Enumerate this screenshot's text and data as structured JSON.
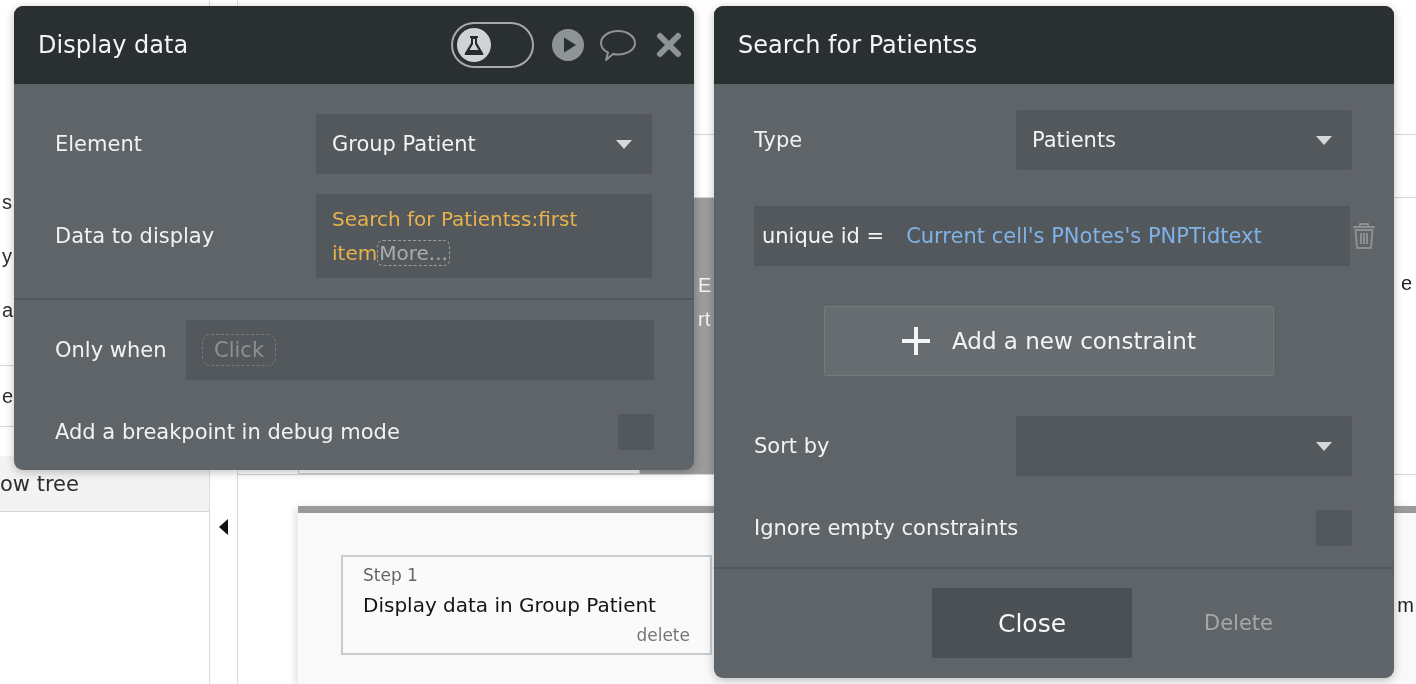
{
  "sidebar": {
    "items": [
      {
        "label": "s",
        "kind": "plain"
      },
      {
        "label": "y",
        "kind": "plain"
      },
      {
        "label": "a",
        "kind": "plain"
      },
      {
        "label": "e",
        "kind": "boxed"
      }
    ],
    "tree_button": {
      "label": "ow tree"
    }
  },
  "canvas": {
    "element_texts": [
      "E",
      "rt"
    ],
    "right_text": "e"
  },
  "workflow": {
    "step": {
      "number": "Step 1",
      "title": "Display data in Group Patient",
      "delete": "delete"
    },
    "right_text": "m"
  },
  "display_data_dialog": {
    "title": "Display data",
    "debug_toggle": {
      "on": false
    },
    "element": {
      "label": "Element",
      "value": "Group Patient"
    },
    "data_to_display": {
      "label": "Data to display",
      "value": "Search for Patientss:first item",
      "more": "More..."
    },
    "only_when": {
      "label": "Only when",
      "prompt": "Click"
    },
    "breakpoint": {
      "label": "Add a breakpoint in debug mode",
      "checked": false
    }
  },
  "search_dialog": {
    "title": "Search for Patientss",
    "type": {
      "label": "Type",
      "value": "Patients"
    },
    "constraints": [
      {
        "key": "unique id =",
        "value": "Current cell's PNotes's PNPTidtext"
      }
    ],
    "add_constraint": "Add a new constraint",
    "sort_by": {
      "label": "Sort by"
    },
    "ignore_empty": {
      "label": "Ignore empty constraints",
      "checked": false
    },
    "buttons": {
      "close": "Close",
      "delete": "Delete"
    }
  }
}
